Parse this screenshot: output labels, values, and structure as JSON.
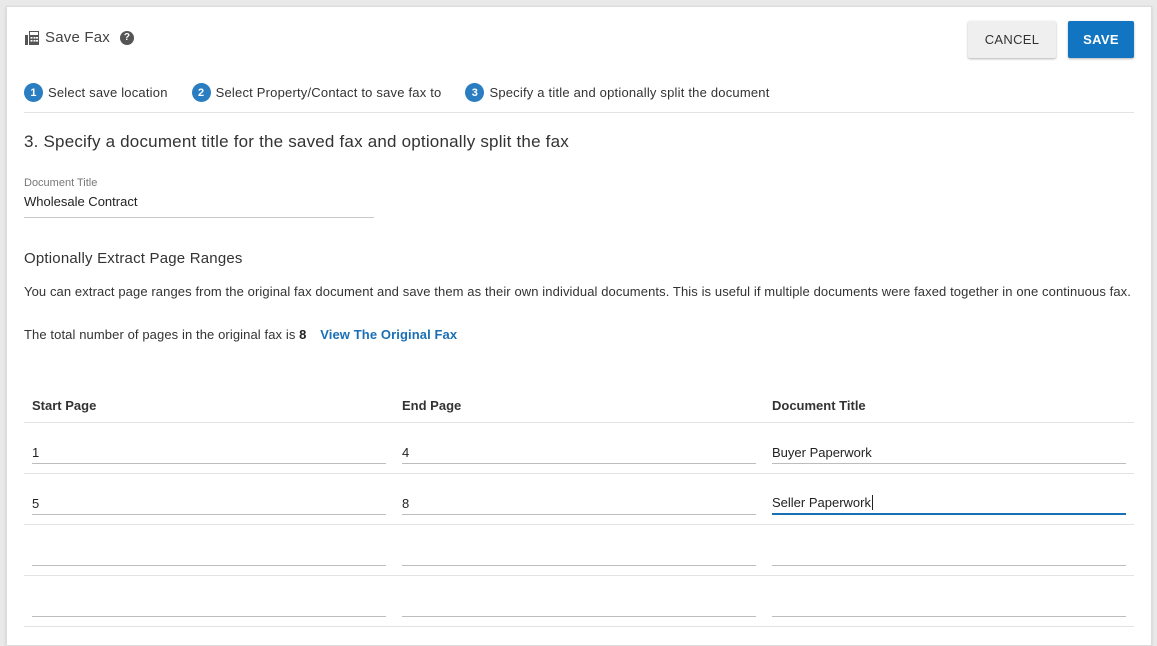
{
  "header": {
    "title": "Save Fax",
    "fax_icon": "fax-icon",
    "help_icon": "help-icon",
    "help_glyph": "?",
    "cancel_label": "CANCEL",
    "save_label": "SAVE"
  },
  "steps": [
    {
      "num": "1",
      "label": "Select save location"
    },
    {
      "num": "2",
      "label": "Select Property/Contact to save fax to"
    },
    {
      "num": "3",
      "label": "Specify a title and optionally split the document"
    }
  ],
  "main": {
    "heading": "3. Specify a document title for the saved fax and optionally split the fax",
    "doc_title_label": "Document Title",
    "doc_title_value": "Wholesale Contract",
    "extract_heading": "Optionally Extract Page Ranges",
    "description": "You can extract page ranges from the original fax document and save them as their own individual documents. This is useful if multiple documents were faxed together in one continuous fax.",
    "total_text": "The total number of pages in the original fax is",
    "total_pages": "8",
    "view_link": "View The Original Fax"
  },
  "table": {
    "columns": [
      "Start Page",
      "End Page",
      "Document Title"
    ],
    "rows": [
      [
        "1",
        "4",
        "Buyer Paperwork"
      ],
      [
        "5",
        "8",
        "Seller Paperwork"
      ],
      [
        "",
        "",
        ""
      ],
      [
        "",
        "",
        ""
      ]
    ]
  },
  "colors": {
    "accent": "#1275c1",
    "link": "#1a6fb5",
    "step_badge": "#2a7dc0"
  }
}
